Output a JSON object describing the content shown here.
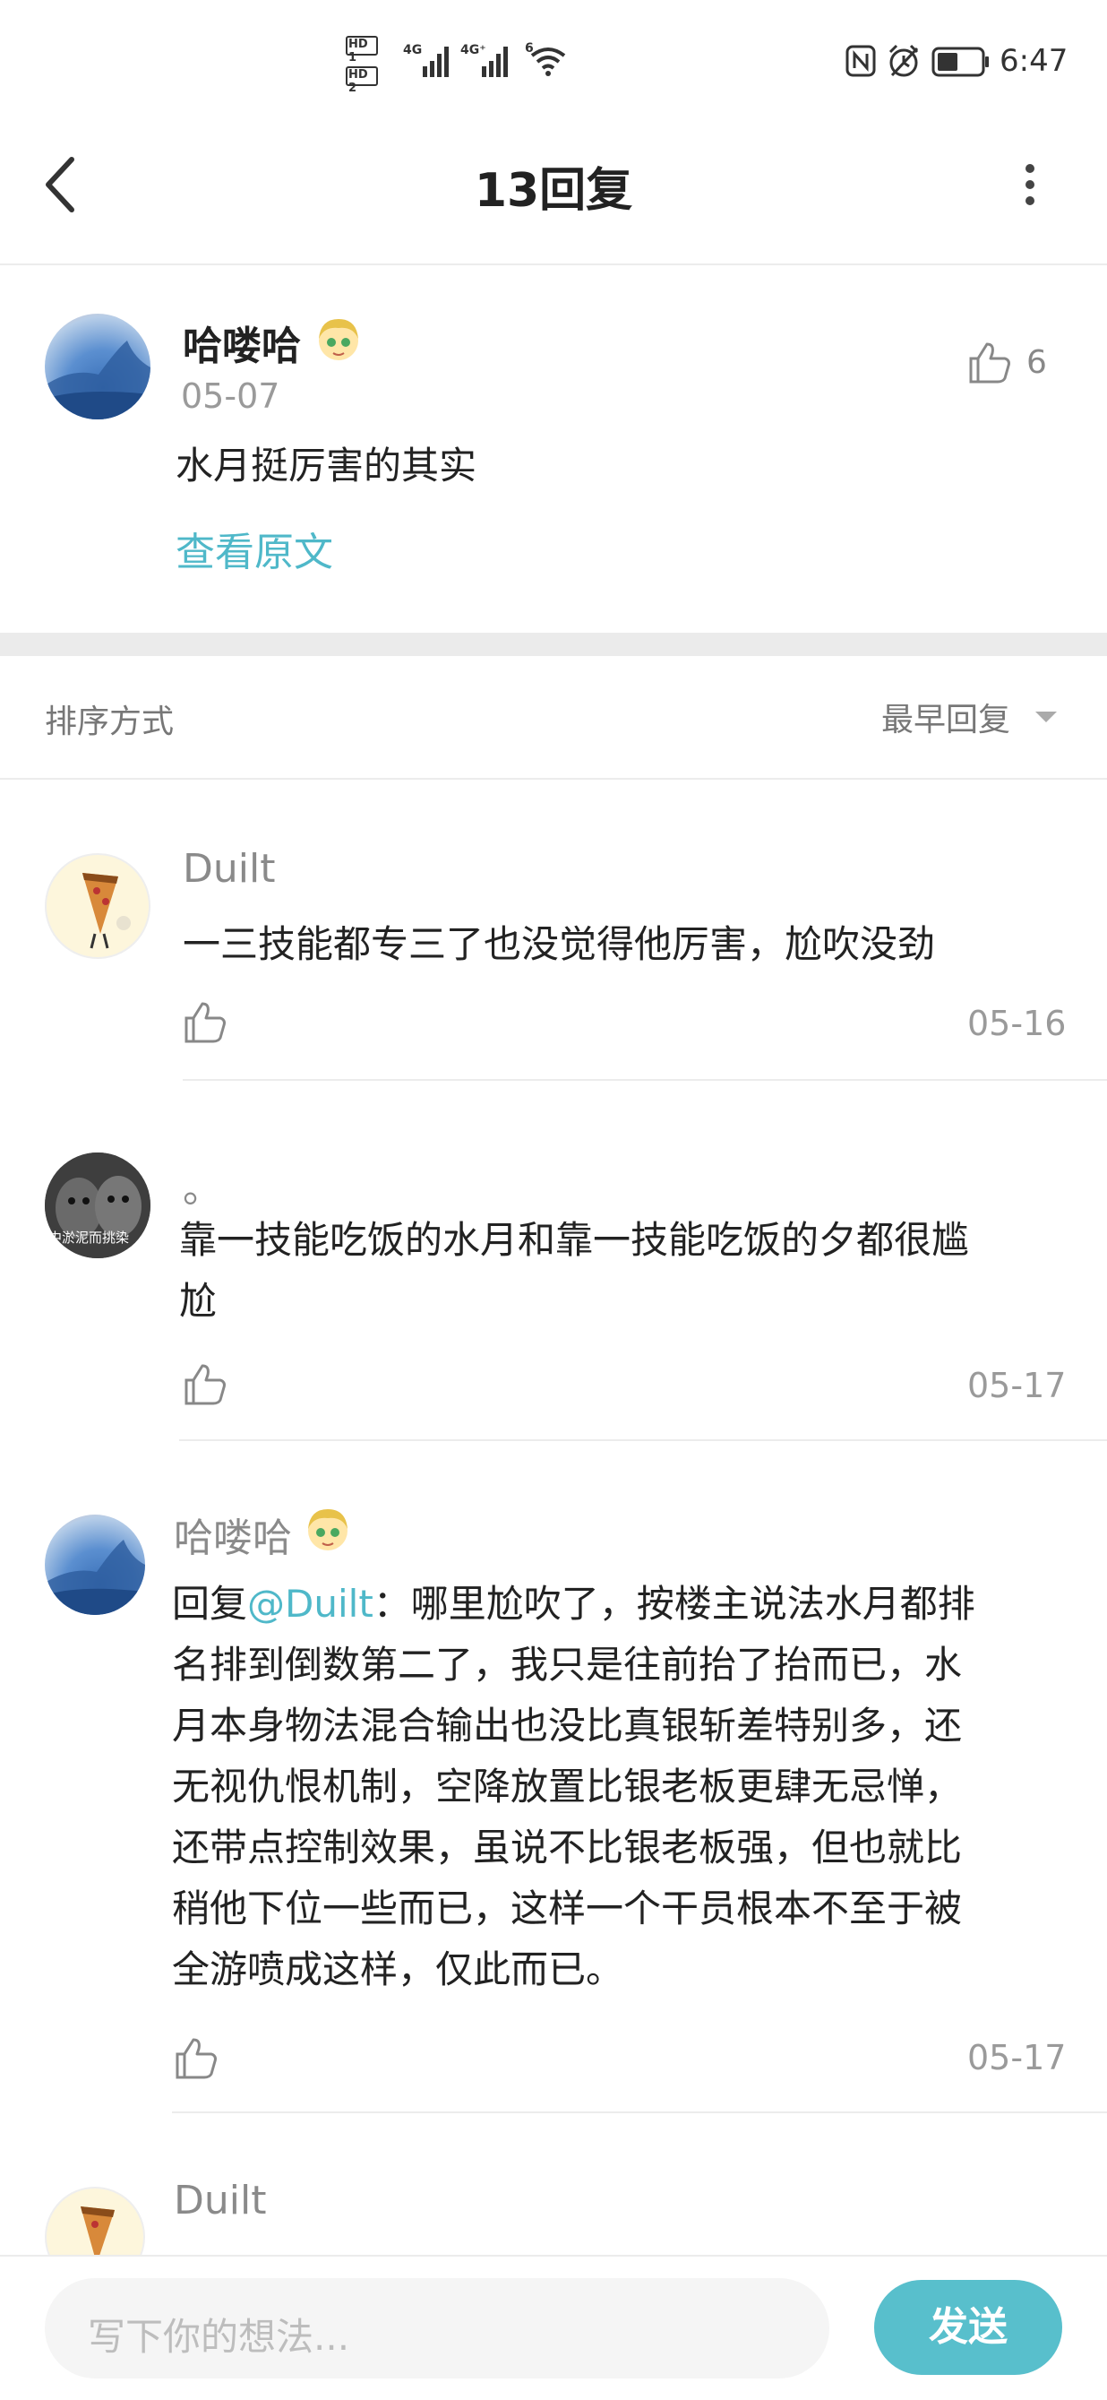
{
  "status_bar": {
    "hd1": "HD 1",
    "hd2": "HD 2",
    "net1": "4G",
    "net2": "4G⁺",
    "wifi": "6",
    "time": "6:47",
    "icons": [
      "nfc-icon",
      "alarm-icon",
      "battery-icon",
      "wifi-icon",
      "signal-icon"
    ]
  },
  "header": {
    "title": "13回复",
    "back_icon": "chevron-left-icon",
    "more_icon": "more-vertical-icon"
  },
  "original_post": {
    "username": "哈喽哈",
    "date": "05-07",
    "text": "水月挺厉害的其实",
    "like_count": "6",
    "view_original": "查看原文"
  },
  "sort_bar": {
    "label": "排序方式",
    "selected": "最早回复"
  },
  "replies": [
    {
      "username": "Duilt",
      "text": "一三技能都专三了也没觉得他厉害，尬吹没劲",
      "date": "05-16"
    },
    {
      "username": "。",
      "text_line1": "靠一技能吃饭的水月和靠一技能吃饭的夕都很尴",
      "text_line2": "尬",
      "date": "05-17",
      "avatar_caption": "中淤泥而挑染"
    },
    {
      "username": "哈喽哈",
      "lines": [
        "回复@Duilt：哪里尬吹了，按楼主说法水月都排",
        "名排到倒数第二了，我只是往前抬了抬而已，水",
        "月本身物法混合输出也没比真银斩差特别多，还",
        "无视仇恨机制，空降放置比银老板更肆无忌惮，",
        "还带点控制效果，虽说不比银老板强，但也就比",
        "稍他下位一些而已，这样一个干员根本不至于被",
        "全游喷成这样，仅此而已。"
      ],
      "date": "05-17"
    },
    {
      "username": "Duilt"
    }
  ],
  "composer": {
    "placeholder": "写下你的想法...",
    "send_label": "发送"
  },
  "colors": {
    "accent": "#58bfcc",
    "link": "#4fb8c9",
    "mention": "#4fb8c9"
  }
}
